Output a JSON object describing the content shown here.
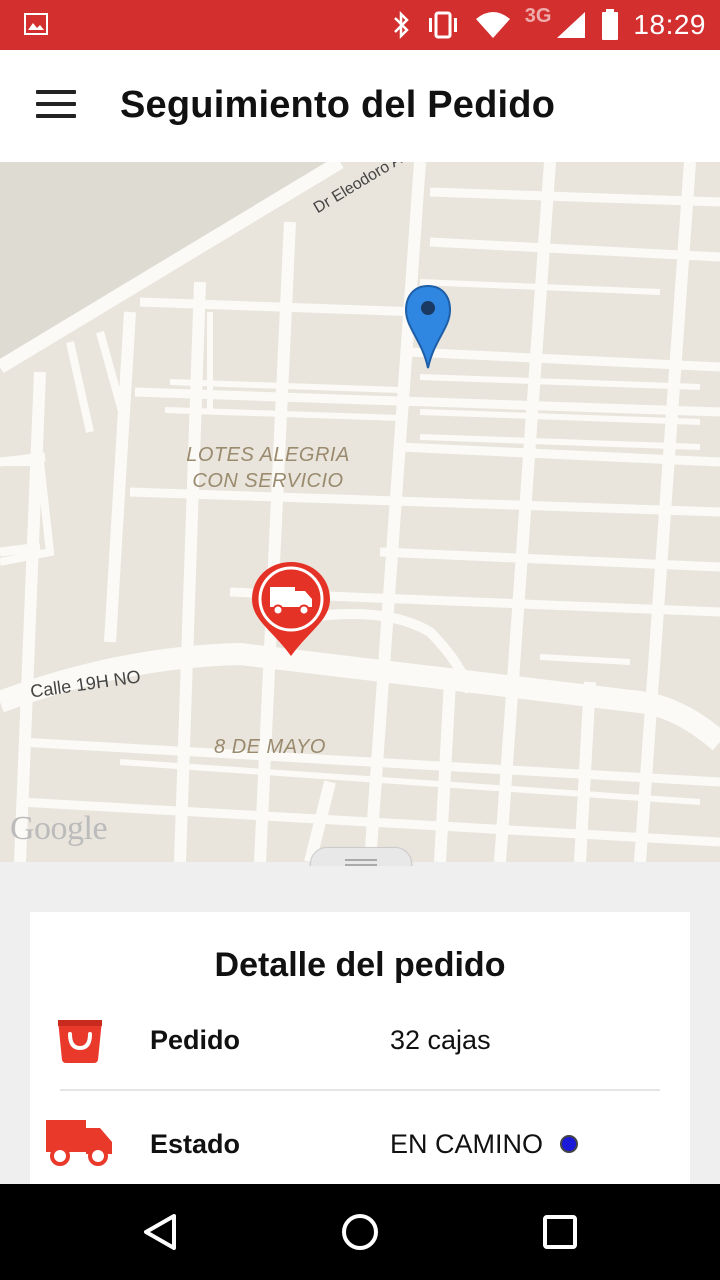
{
  "status_bar": {
    "time": "18:29",
    "network": "3G",
    "icons": [
      "image-icon",
      "bluetooth-icon",
      "vibrate-icon",
      "wifi-icon",
      "signal-icon",
      "battery-icon"
    ]
  },
  "app_bar": {
    "title": "Seguimiento del Pedido",
    "menu_icon": "menu-icon"
  },
  "map": {
    "labels": {
      "neighborhood_1_line1": "LOTES ALEGRIA",
      "neighborhood_1_line2": "CON SERVICIO",
      "neighborhood_2": "8 DE MAYO",
      "street_1": "Calle 19H NO",
      "street_2": "Dr Eleodoro Ar"
    },
    "attribution": "Google",
    "markers": [
      "destination-pin-icon",
      "delivery-truck-marker-icon"
    ]
  },
  "details": {
    "heading": "Detalle del pedido",
    "rows": [
      {
        "icon": "shopping-bag-icon",
        "label": "Pedido",
        "value": "32 cajas"
      },
      {
        "icon": "delivery-truck-icon",
        "label": "Estado",
        "value": "EN CAMINO"
      }
    ]
  },
  "colors": {
    "primary": "#d32f2f",
    "accent_red": "#e8392b",
    "status_dot": "#1a1ad8",
    "pin_blue": "#2f87e2"
  },
  "nav_bar": {
    "buttons": [
      "back-icon",
      "home-icon",
      "recents-icon"
    ]
  }
}
